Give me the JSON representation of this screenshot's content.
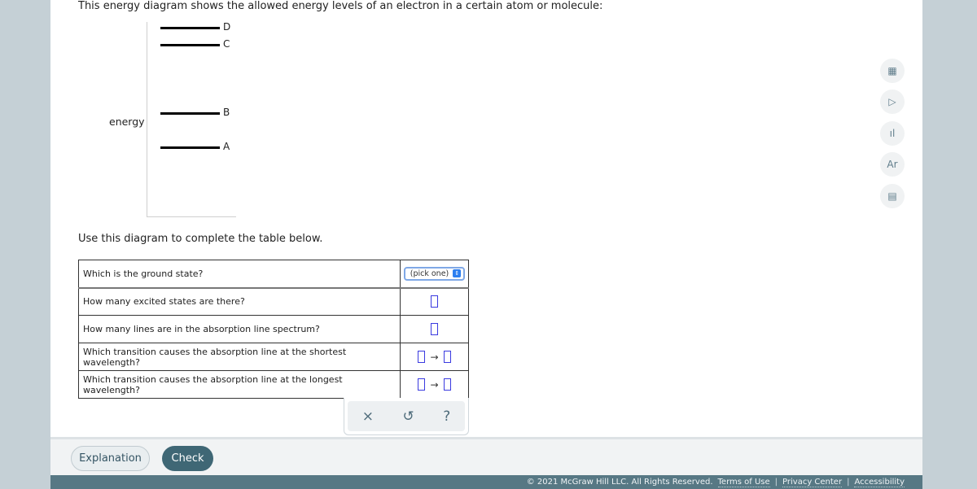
{
  "intro": "This energy diagram shows the allowed energy levels of an electron in a certain atom or molecule:",
  "diagram": {
    "axis_label": "energy",
    "levels": [
      {
        "label": "D",
        "rank": 4
      },
      {
        "label": "C",
        "rank": 3
      },
      {
        "label": "B",
        "rank": 2
      },
      {
        "label": "A",
        "rank": 1
      }
    ]
  },
  "instruction": "Use this diagram to complete the table below.",
  "table": {
    "rows": [
      {
        "question": "Which is the ground state?",
        "answer_type": "select",
        "select_value": "(pick one)"
      },
      {
        "question": "How many excited states are there?",
        "answer_type": "box"
      },
      {
        "question": "How many lines are in the absorption line spectrum?",
        "answer_type": "box"
      },
      {
        "question": "Which transition causes the absorption line at the shortest wavelength?",
        "answer_type": "transition",
        "arrow": "→"
      },
      {
        "question": "Which transition causes the absorption line at the longest wavelength?",
        "answer_type": "transition",
        "arrow": "→"
      }
    ]
  },
  "tool_panel": {
    "clear": "×",
    "undo": "↺",
    "help": "?"
  },
  "side_tools": [
    "calculator-icon",
    "video-icon",
    "chart-icon",
    "periodic-table-icon",
    "reference-icon"
  ],
  "buttons": {
    "explanation": "Explanation",
    "check": "Check"
  },
  "footer": {
    "copyright": "© 2021 McGraw Hill LLC. All Rights Reserved.",
    "links": [
      "Terms of Use",
      "Privacy Center",
      "Accessibility"
    ],
    "separator": "|"
  }
}
